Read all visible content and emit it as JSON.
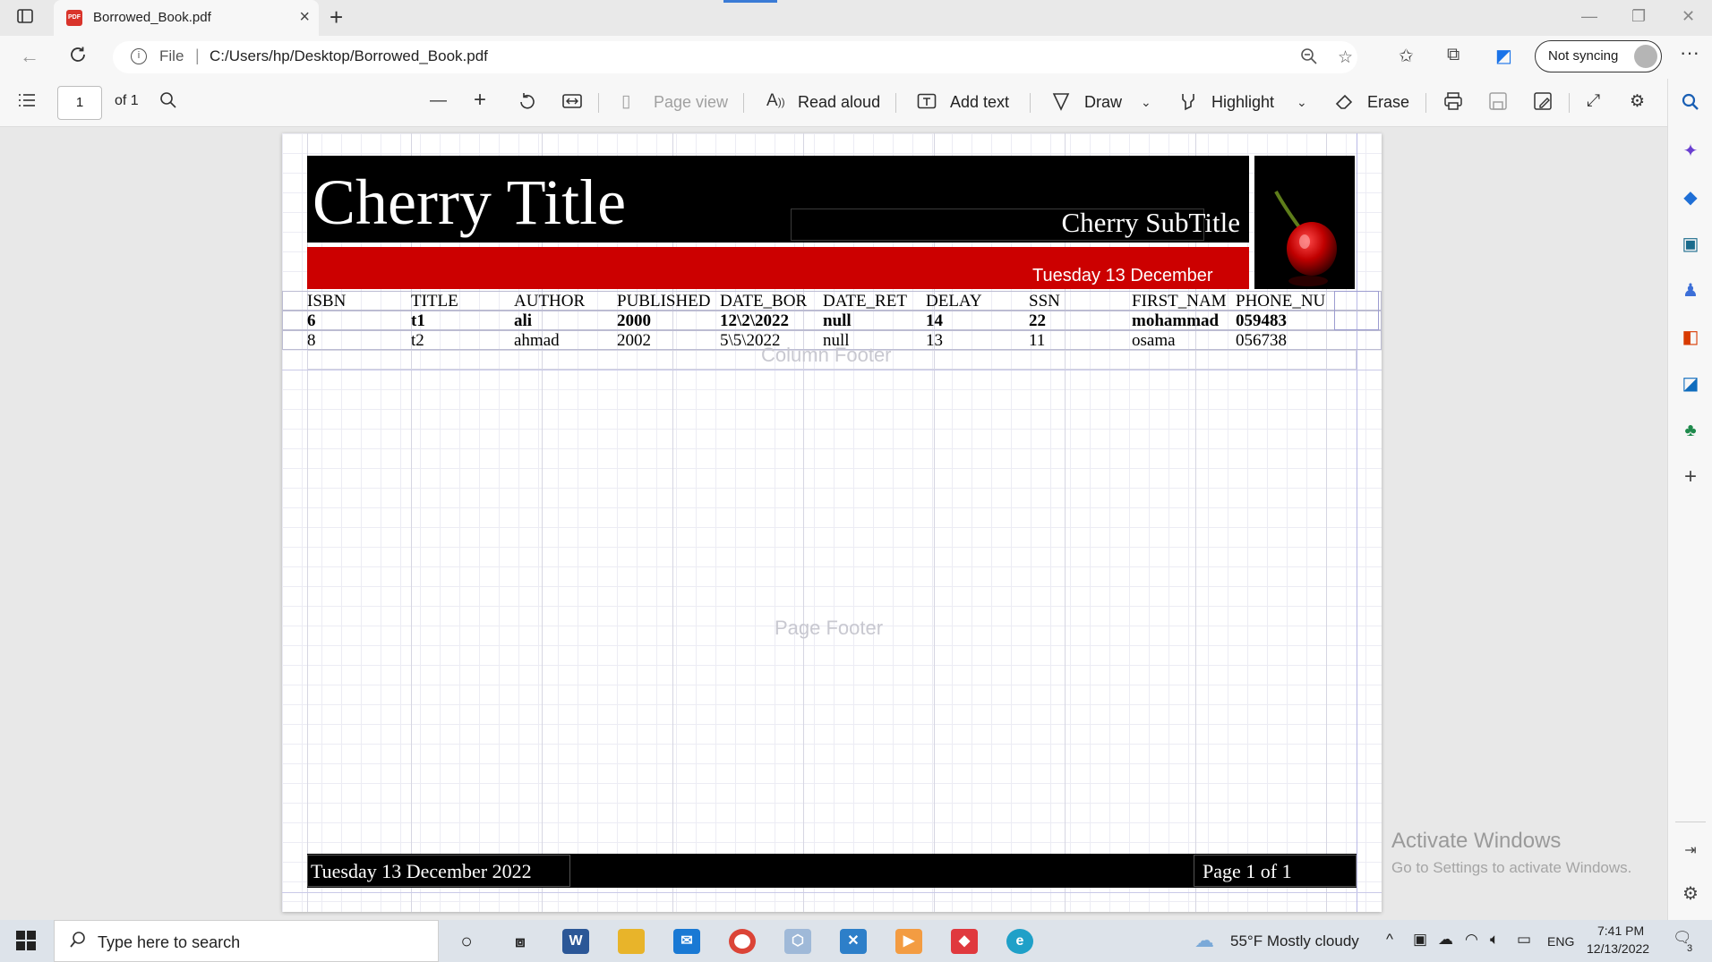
{
  "browser": {
    "tab_title": "Borrowed_Book.pdf",
    "tab_pdf_badge": "PDF",
    "url_scheme_label": "File",
    "url": "C:/Users/hp/Desktop/Borrowed_Book.pdf",
    "sync_label": "Not syncing"
  },
  "pdf_toolbar": {
    "page_number": "1",
    "page_of": "of 1",
    "page_view": "Page view",
    "read_aloud": "Read aloud",
    "add_text": "Add text",
    "draw": "Draw",
    "highlight": "Highlight",
    "erase": "Erase"
  },
  "report": {
    "title": "Cherry Title",
    "subtitle": "Cherry SubTitle",
    "header_date": "Tuesday 13 December",
    "columns": [
      "ISBN",
      "TITLE",
      "AUTHOR",
      "PUBLISHED",
      "DATE_BOR",
      "DATE_RET",
      "DELAY",
      "SSN",
      "FIRST_NAM",
      "PHONE_NU"
    ],
    "rows": [
      [
        "6",
        "t1",
        "ali",
        "2000",
        "12\\2\\2022",
        "null",
        "14",
        "22",
        "mohammad",
        "059483"
      ],
      [
        "8",
        "t2",
        "ahmad",
        "2002",
        "5\\5\\2022",
        "null",
        "13",
        "11",
        "osama",
        "056738"
      ]
    ],
    "column_footer_label": "Column Footer",
    "page_footer_label": "Page Footer",
    "footer_date": "Tuesday 13 December 2022",
    "footer_page": "Page 1 of 1"
  },
  "watermark": {
    "line1": "Activate Windows",
    "line2": "Go to Settings to activate Windows."
  },
  "taskbar": {
    "search_placeholder": "Type here to search",
    "weather": "55°F  Mostly cloudy",
    "language": "ENG",
    "time": "7:41 PM",
    "date": "12/13/2022",
    "notification_count": "3"
  },
  "colors": {
    "red_band": "#cc0000",
    "black_band": "#000000",
    "edge_accent": "#3b7bd6"
  }
}
